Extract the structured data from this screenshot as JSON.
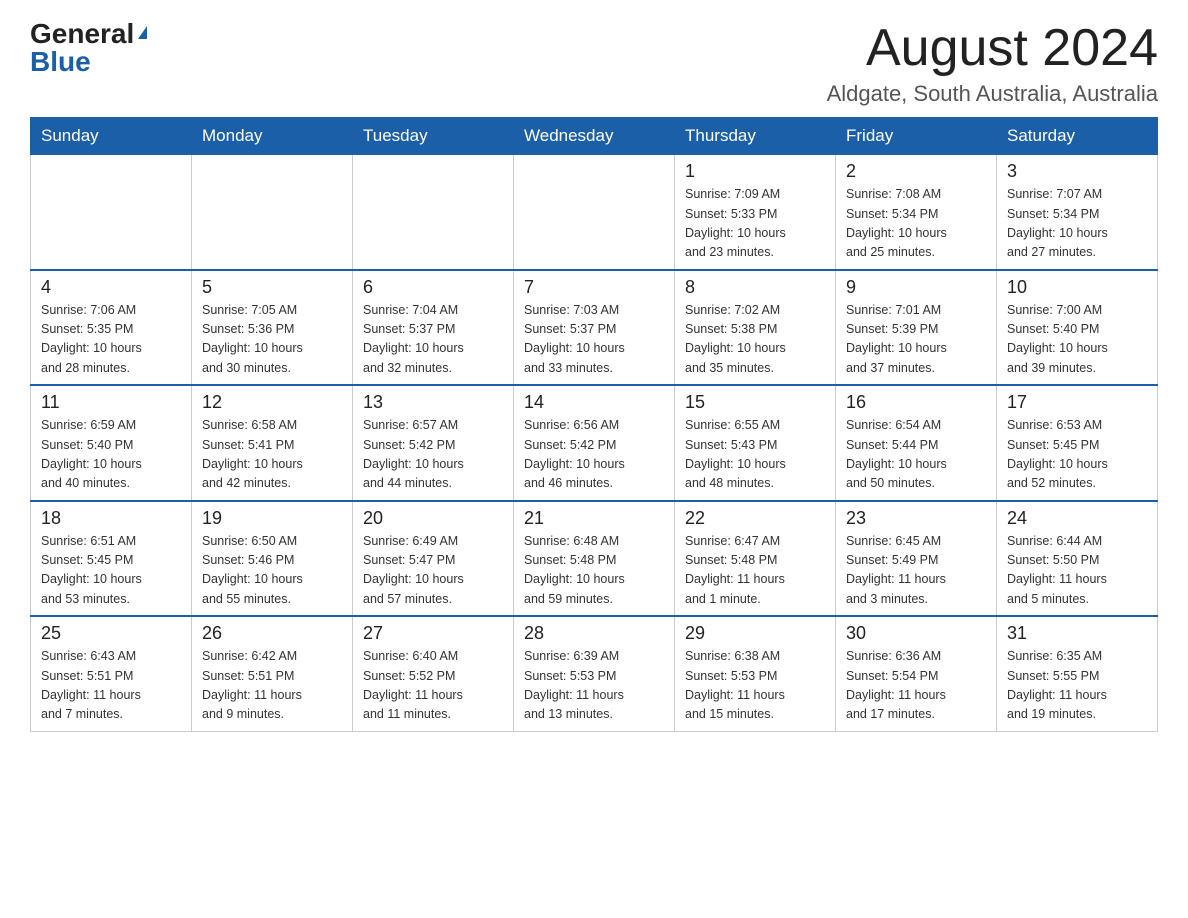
{
  "logo": {
    "general": "General",
    "blue": "Blue"
  },
  "title": "August 2024",
  "location": "Aldgate, South Australia, Australia",
  "days_of_week": [
    "Sunday",
    "Monday",
    "Tuesday",
    "Wednesday",
    "Thursday",
    "Friday",
    "Saturday"
  ],
  "weeks": [
    [
      {
        "day": "",
        "info": ""
      },
      {
        "day": "",
        "info": ""
      },
      {
        "day": "",
        "info": ""
      },
      {
        "day": "",
        "info": ""
      },
      {
        "day": "1",
        "info": "Sunrise: 7:09 AM\nSunset: 5:33 PM\nDaylight: 10 hours\nand 23 minutes."
      },
      {
        "day": "2",
        "info": "Sunrise: 7:08 AM\nSunset: 5:34 PM\nDaylight: 10 hours\nand 25 minutes."
      },
      {
        "day": "3",
        "info": "Sunrise: 7:07 AM\nSunset: 5:34 PM\nDaylight: 10 hours\nand 27 minutes."
      }
    ],
    [
      {
        "day": "4",
        "info": "Sunrise: 7:06 AM\nSunset: 5:35 PM\nDaylight: 10 hours\nand 28 minutes."
      },
      {
        "day": "5",
        "info": "Sunrise: 7:05 AM\nSunset: 5:36 PM\nDaylight: 10 hours\nand 30 minutes."
      },
      {
        "day": "6",
        "info": "Sunrise: 7:04 AM\nSunset: 5:37 PM\nDaylight: 10 hours\nand 32 minutes."
      },
      {
        "day": "7",
        "info": "Sunrise: 7:03 AM\nSunset: 5:37 PM\nDaylight: 10 hours\nand 33 minutes."
      },
      {
        "day": "8",
        "info": "Sunrise: 7:02 AM\nSunset: 5:38 PM\nDaylight: 10 hours\nand 35 minutes."
      },
      {
        "day": "9",
        "info": "Sunrise: 7:01 AM\nSunset: 5:39 PM\nDaylight: 10 hours\nand 37 minutes."
      },
      {
        "day": "10",
        "info": "Sunrise: 7:00 AM\nSunset: 5:40 PM\nDaylight: 10 hours\nand 39 minutes."
      }
    ],
    [
      {
        "day": "11",
        "info": "Sunrise: 6:59 AM\nSunset: 5:40 PM\nDaylight: 10 hours\nand 40 minutes."
      },
      {
        "day": "12",
        "info": "Sunrise: 6:58 AM\nSunset: 5:41 PM\nDaylight: 10 hours\nand 42 minutes."
      },
      {
        "day": "13",
        "info": "Sunrise: 6:57 AM\nSunset: 5:42 PM\nDaylight: 10 hours\nand 44 minutes."
      },
      {
        "day": "14",
        "info": "Sunrise: 6:56 AM\nSunset: 5:42 PM\nDaylight: 10 hours\nand 46 minutes."
      },
      {
        "day": "15",
        "info": "Sunrise: 6:55 AM\nSunset: 5:43 PM\nDaylight: 10 hours\nand 48 minutes."
      },
      {
        "day": "16",
        "info": "Sunrise: 6:54 AM\nSunset: 5:44 PM\nDaylight: 10 hours\nand 50 minutes."
      },
      {
        "day": "17",
        "info": "Sunrise: 6:53 AM\nSunset: 5:45 PM\nDaylight: 10 hours\nand 52 minutes."
      }
    ],
    [
      {
        "day": "18",
        "info": "Sunrise: 6:51 AM\nSunset: 5:45 PM\nDaylight: 10 hours\nand 53 minutes."
      },
      {
        "day": "19",
        "info": "Sunrise: 6:50 AM\nSunset: 5:46 PM\nDaylight: 10 hours\nand 55 minutes."
      },
      {
        "day": "20",
        "info": "Sunrise: 6:49 AM\nSunset: 5:47 PM\nDaylight: 10 hours\nand 57 minutes."
      },
      {
        "day": "21",
        "info": "Sunrise: 6:48 AM\nSunset: 5:48 PM\nDaylight: 10 hours\nand 59 minutes."
      },
      {
        "day": "22",
        "info": "Sunrise: 6:47 AM\nSunset: 5:48 PM\nDaylight: 11 hours\nand 1 minute."
      },
      {
        "day": "23",
        "info": "Sunrise: 6:45 AM\nSunset: 5:49 PM\nDaylight: 11 hours\nand 3 minutes."
      },
      {
        "day": "24",
        "info": "Sunrise: 6:44 AM\nSunset: 5:50 PM\nDaylight: 11 hours\nand 5 minutes."
      }
    ],
    [
      {
        "day": "25",
        "info": "Sunrise: 6:43 AM\nSunset: 5:51 PM\nDaylight: 11 hours\nand 7 minutes."
      },
      {
        "day": "26",
        "info": "Sunrise: 6:42 AM\nSunset: 5:51 PM\nDaylight: 11 hours\nand 9 minutes."
      },
      {
        "day": "27",
        "info": "Sunrise: 6:40 AM\nSunset: 5:52 PM\nDaylight: 11 hours\nand 11 minutes."
      },
      {
        "day": "28",
        "info": "Sunrise: 6:39 AM\nSunset: 5:53 PM\nDaylight: 11 hours\nand 13 minutes."
      },
      {
        "day": "29",
        "info": "Sunrise: 6:38 AM\nSunset: 5:53 PM\nDaylight: 11 hours\nand 15 minutes."
      },
      {
        "day": "30",
        "info": "Sunrise: 6:36 AM\nSunset: 5:54 PM\nDaylight: 11 hours\nand 17 minutes."
      },
      {
        "day": "31",
        "info": "Sunrise: 6:35 AM\nSunset: 5:55 PM\nDaylight: 11 hours\nand 19 minutes."
      }
    ]
  ]
}
